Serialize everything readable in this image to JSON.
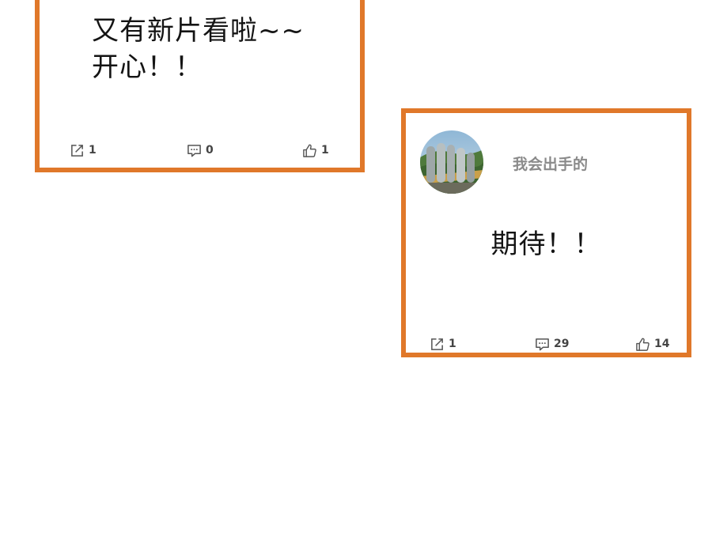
{
  "colors": {
    "card_border": "#e0782a",
    "text": "#141414",
    "author_name": "#8a8a8a",
    "action_text": "#444444"
  },
  "posts": [
    {
      "text_lines": [
        "又有新片看啦~~",
        "开心！！"
      ],
      "actions": {
        "share_icon": "share-icon",
        "share_count": "1",
        "comment_icon": "comment-icon",
        "comment_count": "0",
        "like_icon": "thumbs-up-icon",
        "like_count": "1"
      }
    },
    {
      "author": {
        "name": "我会出手的",
        "avatar_icon": "avatar-photo"
      },
      "text": "期待！！",
      "actions": {
        "share_icon": "share-icon",
        "share_count": "1",
        "comment_icon": "comment-icon",
        "comment_count": "29",
        "like_icon": "thumbs-up-icon",
        "like_count": "14"
      }
    }
  ]
}
